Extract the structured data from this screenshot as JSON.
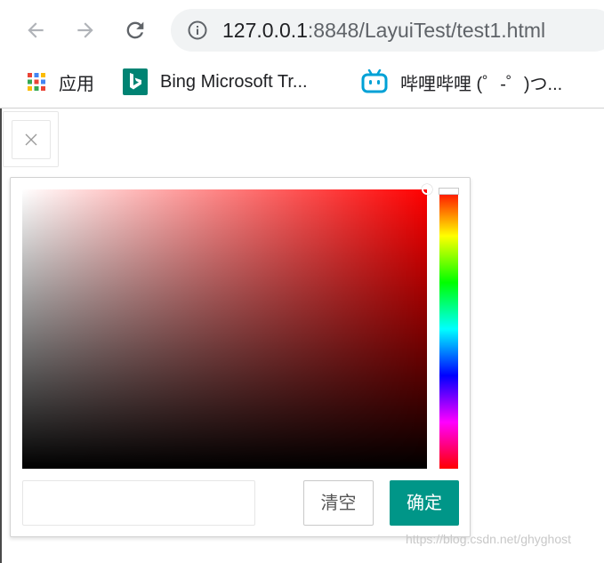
{
  "browser": {
    "url_host": "127.0.0.1",
    "url_rest": ":8848/LayuiTest/test1.html"
  },
  "bookmarks": [
    {
      "label": "应用",
      "icon": "apps-grid-icon"
    },
    {
      "label": "Bing Microsoft Tr...",
      "icon": "bing-icon"
    },
    {
      "label": "哔哩哔哩 (゜-゜)つ...",
      "icon": "bilibili-icon"
    }
  ],
  "colorpicker": {
    "hue": "#ff0000",
    "input_value": "",
    "clear_label": "清空",
    "confirm_label": "确定",
    "confirm_color": "#009688"
  },
  "watermark": "https://blog.csdn.net/ghyghost"
}
